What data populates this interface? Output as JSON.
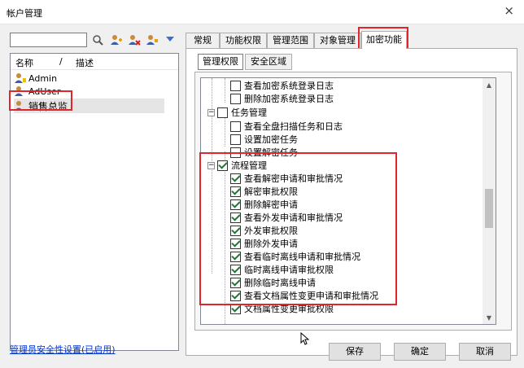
{
  "window": {
    "title": "帐户管理",
    "close_glyph": "×"
  },
  "left": {
    "search": {
      "value": "",
      "placeholder": ""
    },
    "toolbar_icons": [
      "search-icon",
      "add-user-icon",
      "delete-user-icon",
      "edit-user-icon",
      "dropdown-arrow-icon"
    ],
    "columns": {
      "name": "名称",
      "sep": "/",
      "desc": "描述"
    },
    "users": [
      {
        "name": "Admin"
      },
      {
        "name": "AdUser"
      },
      {
        "name": "销售总监"
      }
    ],
    "security_link": "管理员安全性设置(已启用)"
  },
  "tabs": [
    "常规",
    "功能权限",
    "管理范围",
    "对象管理",
    "加密功能"
  ],
  "active_tab": "加密功能",
  "subtabs": [
    "管理权限",
    "安全区域"
  ],
  "active_subtab": "管理权限",
  "tree": [
    {
      "label": "查看加密系统登录日志",
      "checked": false
    },
    {
      "label": "删除加密系统登录日志",
      "checked": false
    },
    {
      "label": "任务管理",
      "checked": false,
      "group": true
    },
    {
      "label": "查看全盘扫描任务和日志",
      "checked": false
    },
    {
      "label": "设置加密任务",
      "checked": false
    },
    {
      "label": "设置解密任务",
      "checked": false
    },
    {
      "label": "流程管理",
      "checked": true,
      "group": true
    },
    {
      "label": "查看解密申请和审批情况",
      "checked": true
    },
    {
      "label": "解密审批权限",
      "checked": true
    },
    {
      "label": "删除解密申请",
      "checked": true
    },
    {
      "label": "查看外发申请和审批情况",
      "checked": true
    },
    {
      "label": "外发审批权限",
      "checked": true
    },
    {
      "label": "删除外发申请",
      "checked": true
    },
    {
      "label": "查看临时离线申请和审批情况",
      "checked": true
    },
    {
      "label": "临时离线申请审批权限",
      "checked": true
    },
    {
      "label": "删除临时离线申请",
      "checked": true
    },
    {
      "label": "查看文档属性变更申请和审批情况",
      "checked": true
    },
    {
      "label": "文档属性变更审批权限",
      "checked": true
    }
  ],
  "buttons": {
    "save": "保存",
    "ok": "确定",
    "cancel": "取消"
  },
  "colors": {
    "highlight": "#e0252b",
    "check": "#1a7f2e",
    "link": "#0033cc"
  }
}
